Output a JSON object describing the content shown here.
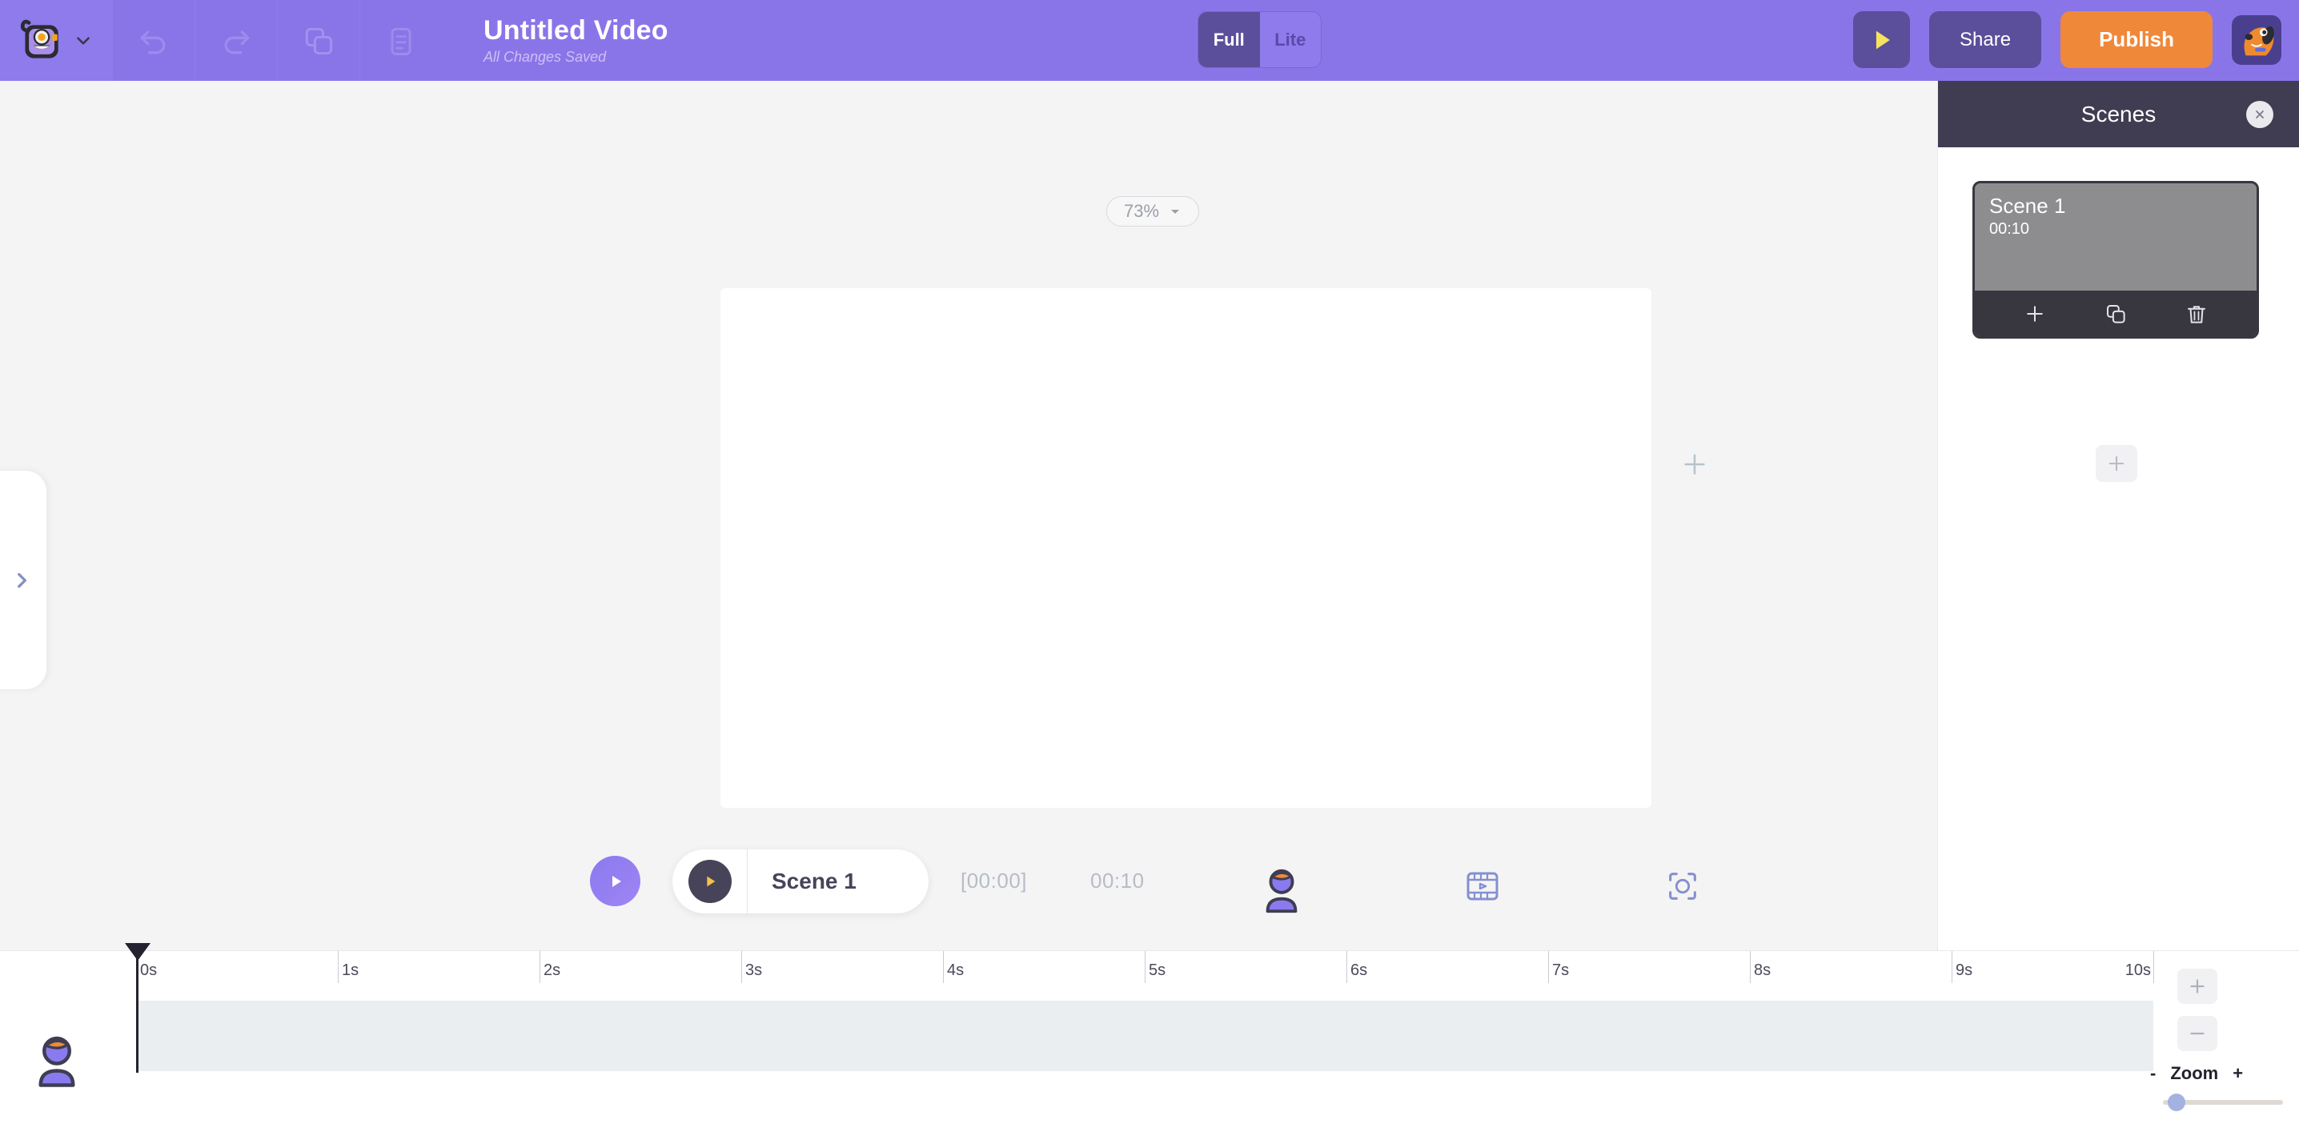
{
  "header": {
    "brand_icon": "monster-logo",
    "brand_caret_icon": "chevron-down-icon",
    "tools": [
      {
        "icon": "undo-icon",
        "name": "undo-button"
      },
      {
        "icon": "redo-icon",
        "name": "redo-button"
      },
      {
        "icon": "copy-icon",
        "name": "duplicate-button"
      },
      {
        "icon": "clipboard-icon",
        "name": "paste-button"
      }
    ],
    "title": "Untitled Video",
    "status": "All Changes Saved",
    "mode": {
      "options": [
        "Full",
        "Lite"
      ],
      "selected": "Full"
    },
    "actions": {
      "preview_icon": "play-icon",
      "share_label": "Share",
      "publish_label": "Publish",
      "avatar_icon": "dog-avatar"
    }
  },
  "stage": {
    "zoom": {
      "value": "73%",
      "caret_icon": "caret-down-icon"
    },
    "canvas_add_icon": "plus-icon",
    "side_handle_icon": "chevron-right-icon"
  },
  "scene_bar": {
    "play_icon": "play-icon",
    "scene_label": "Scene 1",
    "scene_play_icon": "play-icon",
    "time_current": "[00:00]",
    "time_total": "00:10",
    "character_icon": "character-icon",
    "film_icon": "film-strip-icon",
    "focus_icon": "focus-frame-icon"
  },
  "scenes_panel": {
    "title": "Scenes",
    "close_icon": "close-icon",
    "scenes": [
      {
        "name": "Scene 1",
        "duration": "00:10",
        "actions": [
          {
            "icon": "plus-icon",
            "name": "add-scene-after-button"
          },
          {
            "icon": "copy-icon",
            "name": "duplicate-scene-button"
          },
          {
            "icon": "trash-icon",
            "name": "delete-scene-button"
          }
        ]
      }
    ],
    "add_scene_icon": "plus-icon"
  },
  "timeline": {
    "avatar_icon": "character-icon",
    "ticks": [
      "0s",
      "1s",
      "2s",
      "3s",
      "4s",
      "5s",
      "6s",
      "7s",
      "8s",
      "9s",
      "10s"
    ],
    "playhead_position": "0s",
    "zoom_controls": {
      "zoom_in_icon": "plus-icon",
      "zoom_out_icon": "minus-icon",
      "minus_sign": "-",
      "label": "Zoom",
      "plus_sign": "+",
      "slider_value": 8
    }
  },
  "colors": {
    "brand_purple": "#8a75e8",
    "dark_purple": "#5b4f9b",
    "accent_orange": "#f0883a",
    "panel_dark": "#403d52",
    "stage_gray": "#f4f4f5",
    "track_gray": "#ebeef1"
  }
}
